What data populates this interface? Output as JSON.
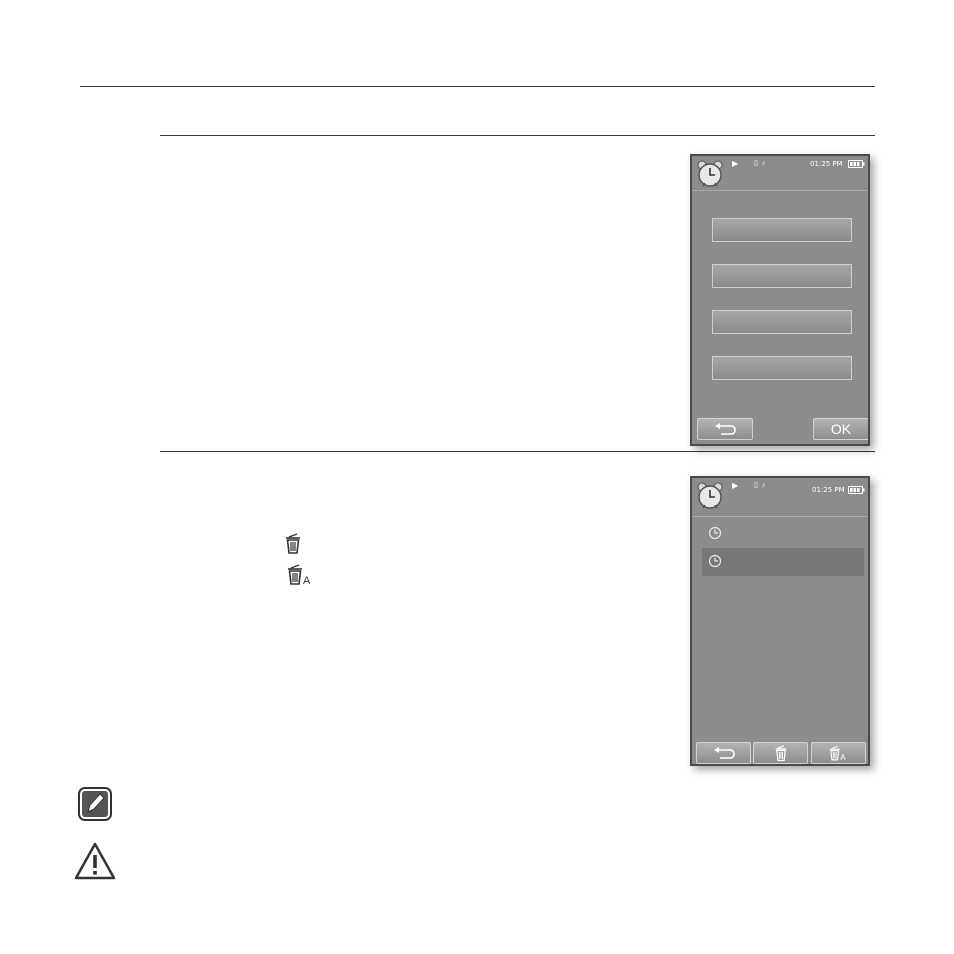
{
  "screen1": {
    "time": "01:25 PM",
    "back_label": "⮌",
    "ok_label": "OK"
  },
  "screen2": {
    "time": "01:25 PM"
  },
  "icons": {
    "delete": "trash-icon",
    "delete_all": "trash-all-icon",
    "note": "note-pencil-icon",
    "caution": "warning-triangle-icon"
  },
  "colors": {
    "screen_bg": "#8c8c8c",
    "selected_row": "#777777",
    "rule": "#3a3a3a"
  }
}
